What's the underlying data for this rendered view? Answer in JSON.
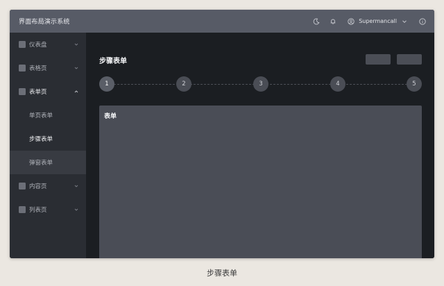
{
  "app": {
    "title": "界面布局演示系统"
  },
  "header": {
    "icons": [
      "moon-icon",
      "bell-icon",
      "user-icon",
      "chevron-down-icon",
      "info-icon"
    ],
    "user_name": "Supermancall"
  },
  "sidebar": {
    "items": [
      {
        "label": "仪表盘",
        "expanded": false
      },
      {
        "label": "表格页",
        "expanded": false
      },
      {
        "label": "表单页",
        "expanded": true,
        "children": [
          {
            "label": "单页表单"
          },
          {
            "label": "步骤表单",
            "current": true
          },
          {
            "label": "弹窗表单"
          }
        ]
      },
      {
        "label": "内容页",
        "expanded": false
      },
      {
        "label": "列表页",
        "expanded": false
      }
    ]
  },
  "main": {
    "title": "步骤表单",
    "steps": [
      "1",
      "2",
      "3",
      "4",
      "5"
    ],
    "active_step": 1,
    "card_title": "表单"
  },
  "caption": "步骤表单",
  "colors": {
    "topbar": "#575b66",
    "sidebar": "#2a2d33",
    "content": "#1b1e22",
    "card": "#4a4d56"
  }
}
